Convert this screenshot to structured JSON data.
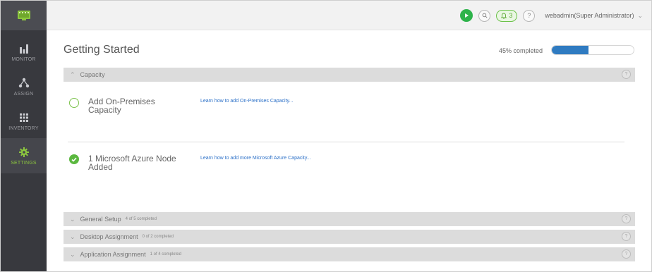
{
  "sidebar": {
    "items": [
      {
        "label": "MONITOR",
        "icon": "bar-chart-icon"
      },
      {
        "label": "ASSIGN",
        "icon": "assign-icon"
      },
      {
        "label": "INVENTORY",
        "icon": "grid-icon"
      },
      {
        "label": "SETTINGS",
        "icon": "gear-icon"
      }
    ],
    "active": "SETTINGS",
    "accent": "#8cc63f"
  },
  "topbar": {
    "alert_count": "3",
    "help_label": "?",
    "user": "webadmin(Super Administrator)"
  },
  "page": {
    "title": "Getting Started",
    "progress_text": "45% completed",
    "progress_value": 0.45
  },
  "sections": {
    "capacity": {
      "name": "Capacity",
      "items": [
        {
          "title_line1": "Add On-Premises",
          "title_line2": "Capacity",
          "link": "Learn how to add On-Premises Capacity...",
          "done": false
        },
        {
          "title_line1": "1 Microsoft Azure Node",
          "title_line2": "Added",
          "link": "Learn how to add more Microsoft Azure Capacity...",
          "done": true
        }
      ]
    },
    "general_setup": {
      "name": "General Setup",
      "sub": "4 of 5 completed"
    },
    "desktop_assignment": {
      "name": "Desktop Assignment",
      "sub": "0 of 2 completed"
    },
    "application_assignment": {
      "name": "Application Assignment",
      "sub": "1 of 4 completed"
    }
  },
  "colors": {
    "sidebar_bg": "#38393e",
    "progress_fill": "#2f7bc1",
    "link": "#2a6fc7",
    "success": "#5bb83f"
  }
}
